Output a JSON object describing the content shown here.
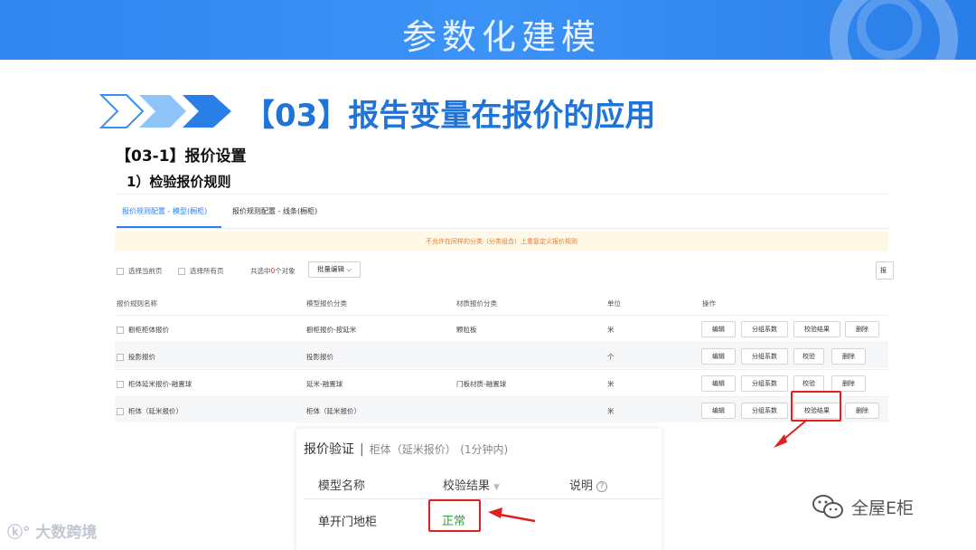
{
  "banner": {
    "title": "参数化建模"
  },
  "section": {
    "title": "【03】报告变量在报价的应用",
    "sub1": "【03-1】报价设置",
    "sub2": "1）检验报价规则"
  },
  "panel": {
    "tabs": [
      {
        "label": "报价规则配置 - 模型(橱柜)",
        "active": true
      },
      {
        "label": "报价规则配置 - 线条(橱柜)",
        "active": false
      }
    ],
    "warning": "不允许在同样的分类（分类组合）上重复定义报价规则",
    "toolbar": {
      "select_page": "选择当前页",
      "select_all": "选择所有页",
      "count_prefix": "共选中",
      "count_value": "0",
      "count_suffix": "个对象",
      "batch_edit": "批量编辑",
      "right_cut": "报"
    },
    "headers": [
      "报价规则名称",
      "模型报价分类",
      "材质报价分类",
      "单位",
      "操作"
    ],
    "rows": [
      {
        "name": "橱柜柜体报价",
        "model_cat": "橱柜报价-按延米",
        "mat_cat": "颗粒板",
        "unit": "米",
        "ops": [
          "编辑",
          "分组系数",
          "校验结果",
          "删除"
        ]
      },
      {
        "name": "投影报价",
        "model_cat": "投影报价",
        "mat_cat": "",
        "unit": "个",
        "ops": [
          "编辑",
          "分组系数",
          "校验",
          "删除"
        ]
      },
      {
        "name": "柜体延米报价-融置球",
        "model_cat": "延米-融置球",
        "mat_cat": "门板材质-融置球",
        "unit": "米",
        "ops": [
          "编辑",
          "分组系数",
          "校验",
          "删除"
        ]
      },
      {
        "name": "柜体（延米报价）",
        "model_cat": "柜体（延米报价）",
        "mat_cat": "",
        "unit": "米",
        "ops": [
          "编辑",
          "分组系数",
          "校验结果",
          "删除"
        ]
      }
    ]
  },
  "popup": {
    "title": "报价验证",
    "subject": "柜体（延米报价）",
    "duration": "(1分钟内)",
    "col_model": "模型名称",
    "col_result": "校验结果",
    "col_note": "说明",
    "row_model": "单开门地柜",
    "row_result": "正常"
  },
  "watermark": {
    "left": "大数跨境",
    "right": "全屋E柜"
  },
  "colors": {
    "banner": "#2f86f0",
    "heading_blue": "#1e74d8",
    "annotation_red": "#e02020",
    "ok_green": "#26a83a",
    "warn_orange": "#e07b39"
  }
}
